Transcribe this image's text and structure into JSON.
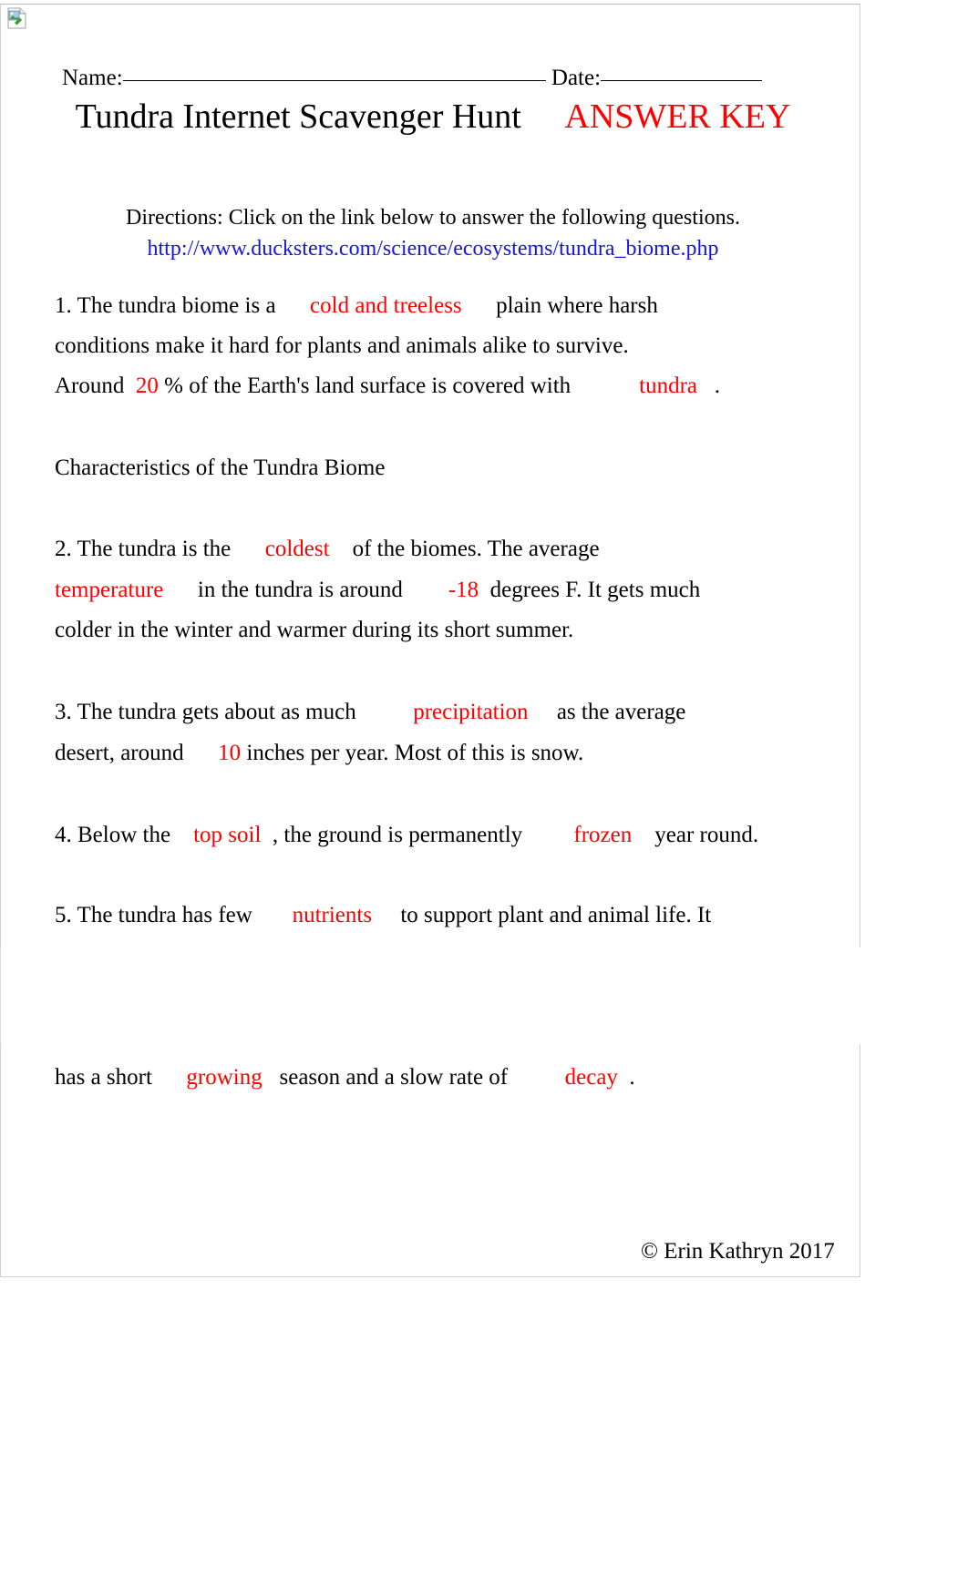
{
  "document": {
    "broken_image_icon": "broken-image-icon",
    "name_label": "Name:",
    "date_label": "Date:",
    "title_main": "Tundra Internet Scavenger Hunt",
    "title_answer_key": "ANSWER KEY",
    "directions": "Directions: Click on the link below to answer the following questions.",
    "source_url": "http://www.ducksters.com/science/ecosystems/tundra_biome.php",
    "section_heading": "Characteristics of the Tundra Biome",
    "footer": "© Erin Kathryn 2017"
  },
  "questions": [
    {
      "number": "1.",
      "line1_a": "1. The tundra biome is a",
      "line1_answer": "cold and treeless",
      "line1_b": "plain where harsh",
      "line2": "conditions make it hard for plants and animals alike to survive.",
      "line3_a": "Around",
      "line3_answer1": "20",
      "line3_b": "% of the Earth's land surface is covered with",
      "line3_answer2": "tundra",
      "line3_c": "."
    },
    {
      "number": "2.",
      "line1_a": "2. The tundra is the",
      "line1_answer": "coldest",
      "line1_b": "of the biomes. The average",
      "line2_answer1": "temperature",
      "line2_a": "in the tundra is around",
      "line2_answer2": "-18",
      "line2_b": "degrees F. It gets much",
      "line3": "colder in the winter and warmer during its short summer."
    },
    {
      "number": "3.",
      "line1_a": "3. The tundra gets about as much",
      "line1_answer": "precipitation",
      "line1_b": "as the average",
      "line2_a": "desert, around",
      "line2_answer": "10",
      "line2_b": "inches per year. Most of this is snow."
    },
    {
      "number": "4.",
      "line1_a": "4. Below the",
      "line1_answer1": "top soil",
      "line1_b": ", the ground is permanently",
      "line1_answer2": "frozen",
      "line1_c": "year round."
    },
    {
      "number": "5.",
      "line1_a": "5. The tundra has few",
      "line1_answer": "nutrients",
      "line1_b": "to support plant and animal life. It",
      "line2_a": "has a short",
      "line2_answer1": "growing",
      "line2_b": "season and a slow rate of",
      "line2_answer2": "decay",
      "line2_c": "."
    }
  ],
  "colors": {
    "answer_red": "#ff0000",
    "link_blue": "#1414e6",
    "text_black": "#000000",
    "page_border": "#cfcfcf"
  }
}
